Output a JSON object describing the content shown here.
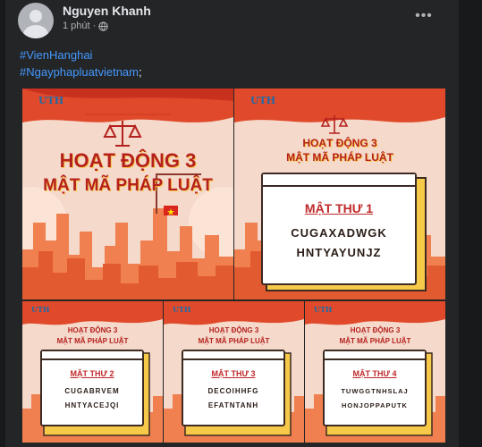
{
  "post": {
    "author": "Nguyen Khanh",
    "time": "1 phút",
    "dot": "·",
    "more_icon": "more-horizontal-icon",
    "hashtags": [
      "#VienHanghai",
      "#Ngayphapluatvietnam"
    ],
    "trailing": ";"
  },
  "gallery": {
    "logo": "UTH",
    "activity_title_line1": "HOẠT ĐỘNG 3",
    "activity_title_line2": "MẬT MÃ PHÁP LUẬT",
    "cards": [
      {
        "title": "MẬT THƯ 1",
        "line1": "CUGAXADWGK",
        "line2": "HNTYAYUNJZ"
      },
      {
        "title": "MẬT THƯ 2",
        "line1": "CUGABRVEM",
        "line2": "HNTYACEJQI"
      },
      {
        "title": "MẬT THƯ 3",
        "line1": "DECOIHHFG",
        "line2": "EFATNTANH"
      },
      {
        "title": "MẬT THƯ 4",
        "line1": "TUWGGTNHSLAJ",
        "line2": "HONJOPPAPUTK"
      }
    ]
  },
  "colors": {
    "background": "#18191a",
    "card": "#242526",
    "hashtag": "#4599ff",
    "poster_red": "#c0282a",
    "poster_cream": "#f6ddd0"
  }
}
